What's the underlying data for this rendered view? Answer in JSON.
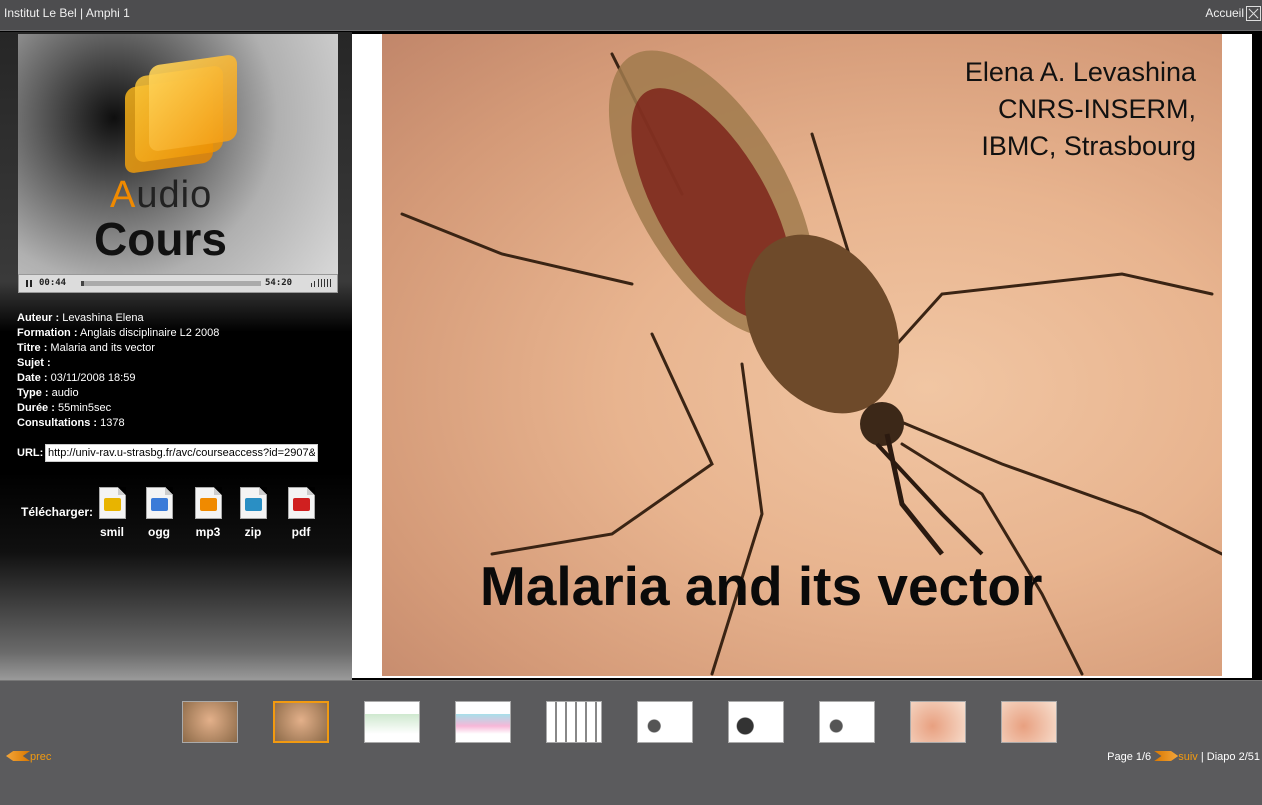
{
  "window": {
    "title": "Institut Le Bel | Amphi 1",
    "home_label": "Accueil"
  },
  "logo": {
    "word1_first": "A",
    "word1_rest": "udio",
    "word2": "Cours"
  },
  "player": {
    "current_time": "00:44",
    "duration": "54:20",
    "progress_fraction": 0.014
  },
  "metadata": [
    {
      "key": "Auteur :",
      "value": "Levashina Elena"
    },
    {
      "key": "Formation :",
      "value": "Anglais disciplinaire L2 2008"
    },
    {
      "key": "Titre :",
      "value": "Malaria and its vector"
    },
    {
      "key": "Sujet :",
      "value": ""
    },
    {
      "key": "Date :",
      "value": "03/11/2008 18:59"
    },
    {
      "key": "Type :",
      "value": "audio"
    },
    {
      "key": "Durée :",
      "value": "55min5sec"
    },
    {
      "key": "Consultations :",
      "value": "1378"
    }
  ],
  "url": {
    "label": "URL:",
    "value": "http://univ-rav.u-strasbg.fr/avc/courseaccess?id=2907&"
  },
  "downloads": {
    "label": "Télécharger:",
    "items": [
      {
        "label": "smil",
        "icon": "smil-file-icon",
        "color": "#e8b400"
      },
      {
        "label": "ogg",
        "icon": "ogg-file-icon",
        "color": "#3b7bd8"
      },
      {
        "label": "mp3",
        "icon": "mp3-file-icon",
        "color": "#f08a00"
      },
      {
        "label": "zip",
        "icon": "zip-file-icon",
        "color": "#2a8fc4"
      },
      {
        "label": "pdf",
        "icon": "pdf-file-icon",
        "color": "#d02020"
      }
    ]
  },
  "slide": {
    "credit_lines": [
      "Elena A. Levashina",
      "CNRS-INSERM,",
      "IBMC, Strasbourg"
    ],
    "title": "Malaria and its vector"
  },
  "thumbnails": {
    "count": 10,
    "active_index": 1
  },
  "navigation": {
    "prev_label": "prec",
    "page_label": "Page 1/6",
    "next_label": "suiv",
    "separator": "|",
    "diapo_label": "Diapo 2/51"
  },
  "colors": {
    "accent": "#f29a10",
    "bar": "#5b5b5d"
  }
}
